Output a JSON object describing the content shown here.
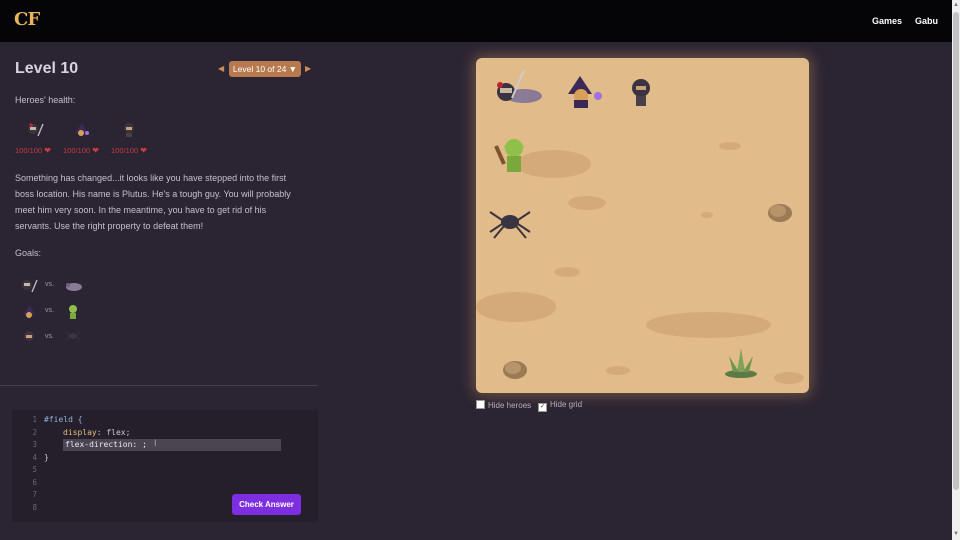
{
  "header": {
    "logo": "CF",
    "nav": [
      "Games",
      "Gabu"
    ]
  },
  "level": {
    "title": "Level 10",
    "selector_label": "Level 10 of 24 ▼",
    "prev_icon": "◀",
    "next_icon": "▶"
  },
  "heroes": {
    "label": "Heroes' health:",
    "health": [
      "100/100",
      "100/100",
      "100/100"
    ],
    "heart": "❤"
  },
  "story": "Something has changed...it looks like you have stepped into the first boss location. His name is Plutus. He's a tough guy. You will probably meet him very soon. In the meantime, you have to get rid of his servants. Use the right property to defeat them!",
  "goals": {
    "label": "Goals:",
    "vs": "vs."
  },
  "editor": {
    "line_numbers": [
      "1",
      "2",
      "3",
      "4",
      "5",
      "6",
      "7",
      "8"
    ],
    "line1": "#field {",
    "line2_prop": "display",
    "line2_val": ": flex;",
    "input_value": "flex-direction: ;",
    "line4": "}",
    "check_label": "Check Answer"
  },
  "options": {
    "hide_heroes": "Hide heroes",
    "hide_grid": "Hide grid",
    "hide_grid_checked": "✓"
  },
  "colors": {
    "accent": "#7c2ee0",
    "board": "#e2bb8a",
    "level_select": "#b77a4f"
  }
}
